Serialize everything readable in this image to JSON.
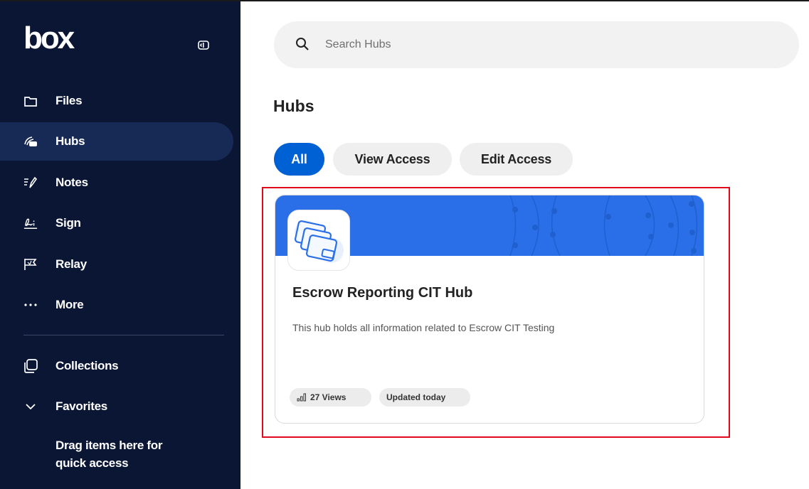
{
  "app": {
    "logo_text": "box"
  },
  "sidebar": {
    "items": [
      {
        "label": "Files",
        "icon": "folder-icon"
      },
      {
        "label": "Hubs",
        "icon": "hubs-icon",
        "active": true
      },
      {
        "label": "Notes",
        "icon": "notes-icon"
      },
      {
        "label": "Sign",
        "icon": "sign-icon"
      },
      {
        "label": "Relay",
        "icon": "relay-icon"
      },
      {
        "label": "More",
        "icon": "more-icon"
      }
    ],
    "collections_label": "Collections",
    "favorites_label": "Favorites",
    "drag_hint_line1": "Drag items here for",
    "drag_hint_line2": "quick access"
  },
  "search": {
    "placeholder": "Search Hubs",
    "value": ""
  },
  "main": {
    "title": "Hubs",
    "filters": [
      {
        "label": "All",
        "active": true
      },
      {
        "label": "View Access",
        "active": false
      },
      {
        "label": "Edit Access",
        "active": false
      }
    ]
  },
  "card": {
    "title": "Escrow Reporting CIT Hub",
    "description": "This hub holds all information related to Escrow CIT Testing",
    "views_label": "27 Views",
    "updated_label": "Updated today"
  },
  "colors": {
    "sidebar_bg": "#0b1634",
    "active_item_bg": "#172a55",
    "accent": "#0061d5",
    "banner": "#2b6fe8",
    "highlight": "#e0081c"
  }
}
